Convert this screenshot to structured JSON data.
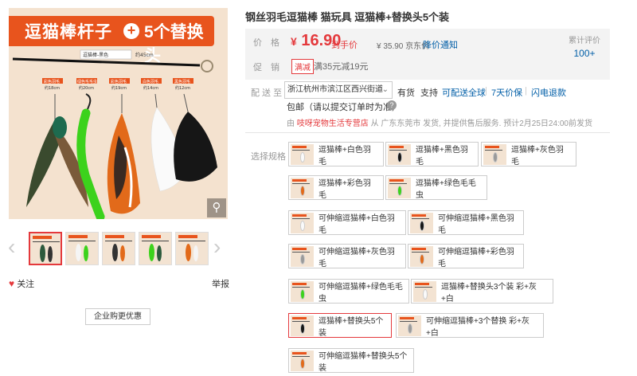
{
  "product_image": {
    "banner_left": "逗猫棒杆子",
    "banner_plus": "+",
    "banner_right": "5个替换头",
    "rod_label": "逗猫棒-黑色",
    "rod_length": "约45cm",
    "feather_labels": [
      "彩色羽毛",
      "绿色毛毛虫",
      "彩色羽毛",
      "白色羽毛",
      "黑色羽毛"
    ],
    "feather_sizes": [
      "约18cm",
      "约20cm",
      "约19cm",
      "约14cm",
      "约12cm"
    ]
  },
  "gallery": {
    "thumb_count": 5,
    "active_index": 0
  },
  "follow_label": "关注",
  "report_label": "举报",
  "company_button": "企业购更优惠",
  "title": "钢丝羽毛逗猫棒 猫玩具 逗猫棒+替换头5个装",
  "price": {
    "label": "价　格",
    "currency": "¥",
    "value": "16.90",
    "tag": "到手价",
    "jd_currency": "¥",
    "jd_value": "35.90",
    "jd_label": "京东价",
    "alert": "降价通知",
    "rating_label": "累计评价",
    "rating_value": "100+"
  },
  "promo": {
    "label": "促　销",
    "badge": "满减",
    "text": "满35元减19元"
  },
  "delivery": {
    "label": "配 送 至",
    "address": "浙江杭州市滨江区西兴街道",
    "stock": "有货",
    "support": "支持",
    "services": [
      "可配送全球",
      "7天价保",
      "闪电退款"
    ],
    "free_ship": "包邮（请以提交订单时为准）",
    "ship_from_prefix": "由",
    "shop": "吱呀宠物生活专营店",
    "ship_from_suffix": "从 广东东莞市 发货, 并提供售后服务. 预计2月25日24:00前发货"
  },
  "spec": {
    "label": "选择规格",
    "options": [
      "逗猫棒+白色羽毛",
      "逗猫棒+黑色羽毛",
      "逗猫棒+灰色羽毛",
      "逗猫棒+彩色羽毛",
      "逗猫棒+绿色毛毛虫",
      "可伸缩逗猫棒+白色羽毛",
      "可伸缩逗猫棒+黑色羽毛",
      "可伸缩逗猫棒+灰色羽毛",
      "可伸缩逗猫棒+彩色羽毛",
      "可伸缩逗猫棒+绿色毛毛虫",
      "逗猫棒+替换头3个装 彩+灰+白",
      "逗猫棒+替换头5个装",
      "可伸缩逗猫棒+3个替换 彩+灰+白",
      "可伸缩逗猫棒+替换头5个装"
    ],
    "selected_index": 11
  },
  "colors": {
    "accent": "#e4393c",
    "link": "#005ea7",
    "banner": "#e8541d"
  }
}
